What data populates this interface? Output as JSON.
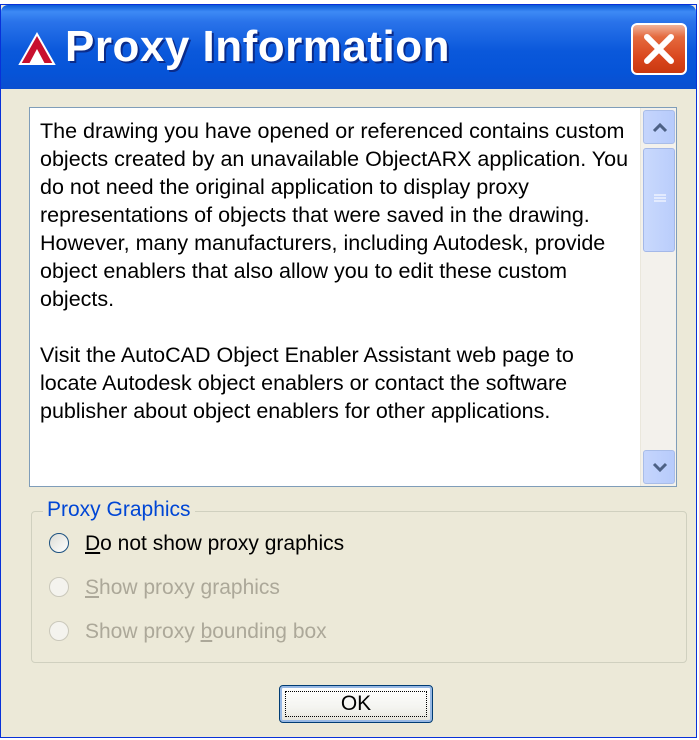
{
  "window": {
    "title": "Proxy Information",
    "app_icon": "autocad-icon",
    "close_icon": "close-icon"
  },
  "message": {
    "paragraph1": "The drawing you have opened or referenced contains custom objects created by an unavailable ObjectARX application. You do not need the original application to display proxy representations of objects that were saved in the drawing. However, many manufacturers, including Autodesk, provide object enablers that also allow you to edit these custom objects.",
    "paragraph2": "Visit the AutoCAD Object Enabler Assistant web page to locate Autodesk object enablers or contact the software publisher about object enablers for other applications."
  },
  "proxy_graphics": {
    "label": "Proxy Graphics",
    "options": [
      {
        "pre": "",
        "mnemonic": "D",
        "post": "o not show proxy graphics",
        "enabled": true
      },
      {
        "pre": "",
        "mnemonic": "S",
        "post": "how proxy graphics",
        "enabled": false
      },
      {
        "pre": "Show proxy ",
        "mnemonic": "b",
        "post": "ounding box",
        "enabled": false
      }
    ]
  },
  "buttons": {
    "ok_label": "OK"
  },
  "colors": {
    "titlebar": "#0a58db",
    "close": "#d9451c",
    "group_label": "#0046d5",
    "disabled_text": "#aca899"
  }
}
